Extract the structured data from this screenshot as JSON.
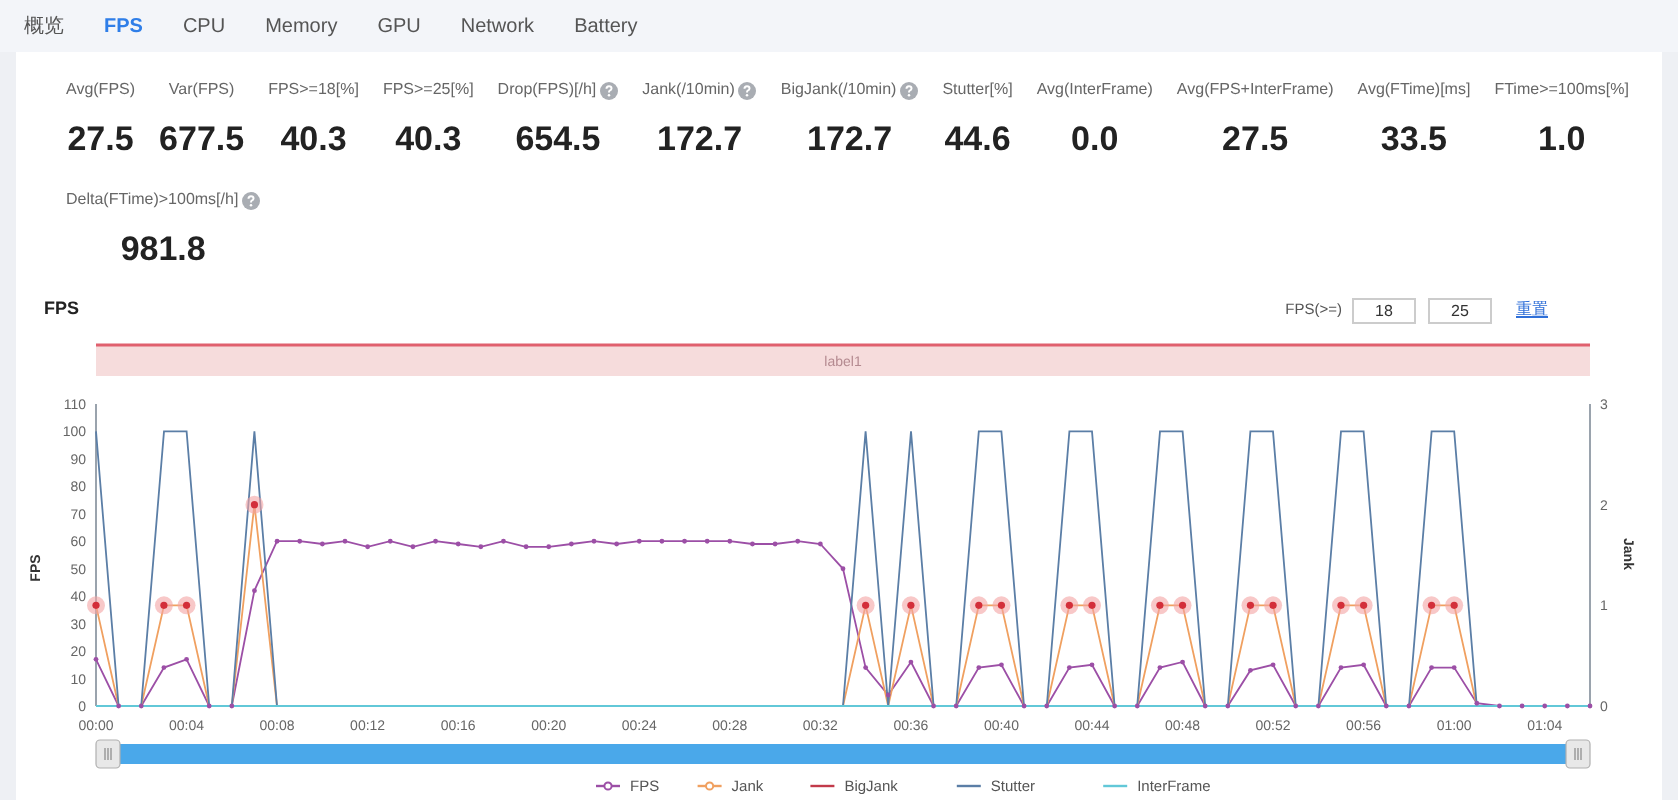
{
  "tabs": [
    {
      "label": "概览",
      "selected": false
    },
    {
      "label": "FPS",
      "selected": true
    },
    {
      "label": "CPU",
      "selected": false
    },
    {
      "label": "Memory",
      "selected": false
    },
    {
      "label": "GPU",
      "selected": false
    },
    {
      "label": "Network",
      "selected": false
    },
    {
      "label": "Battery",
      "selected": false
    }
  ],
  "metric_rows": [
    [
      {
        "label": "Avg(FPS)",
        "value": "27.5",
        "help": false
      },
      {
        "label": "Var(FPS)",
        "value": "677.5",
        "help": false
      },
      {
        "label": "FPS>=18[%]",
        "value": "40.3",
        "help": false
      },
      {
        "label": "FPS>=25[%]",
        "value": "40.3",
        "help": false
      },
      {
        "label": "Drop(FPS)[/h]",
        "value": "654.5",
        "help": true
      },
      {
        "label": "Jank(/10min)",
        "value": "172.7",
        "help": true
      },
      {
        "label": "BigJank(/10min)",
        "value": "172.7",
        "help": true
      },
      {
        "label": "Stutter[%]",
        "value": "44.6",
        "help": false
      },
      {
        "label": "Avg(InterFrame)",
        "value": "0.0",
        "help": false
      },
      {
        "label": "Avg(FPS+InterFrame)",
        "value": "27.5",
        "help": false
      },
      {
        "label": "Avg(FTime)[ms]",
        "value": "33.5",
        "help": false
      },
      {
        "label": "FTime>=100ms[%]",
        "value": "1.0",
        "help": false
      }
    ],
    [
      {
        "label": "Delta(FTime)>100ms[/h]",
        "value": "981.8",
        "help": true
      }
    ]
  ],
  "chart": {
    "filter_label": "FPS(>=)",
    "thresholds": [
      "18",
      "25"
    ],
    "reset_link": "重置",
    "chart_data": {
      "type": "line",
      "title": "FPS",
      "ylabel": "FPS",
      "y2label": "Jank",
      "x": [
        0,
        1,
        2,
        3,
        4,
        5,
        6,
        7,
        8,
        9,
        10,
        11,
        12,
        13,
        14,
        15,
        16,
        17,
        18,
        19,
        20,
        21,
        22,
        23,
        24,
        25,
        26,
        27,
        28,
        29,
        30,
        31,
        32,
        33,
        34,
        35,
        36,
        37,
        38,
        39,
        40,
        41,
        42,
        43,
        44,
        45,
        46,
        47,
        48,
        49,
        50,
        51,
        52,
        53,
        54,
        55,
        56,
        57,
        58,
        59,
        60,
        61,
        62,
        63,
        64,
        65,
        66
      ],
      "xticks": [
        {
          "value": 0,
          "label": "00:00"
        },
        {
          "value": 4,
          "label": "00:04"
        },
        {
          "value": 8,
          "label": "00:08"
        },
        {
          "value": 12,
          "label": "00:12"
        },
        {
          "value": 16,
          "label": "00:16"
        },
        {
          "value": 20,
          "label": "00:20"
        },
        {
          "value": 24,
          "label": "00:24"
        },
        {
          "value": 28,
          "label": "00:28"
        },
        {
          "value": 32,
          "label": "00:32"
        },
        {
          "value": 36,
          "label": "00:36"
        },
        {
          "value": 40,
          "label": "00:40"
        },
        {
          "value": 44,
          "label": "00:44"
        },
        {
          "value": 48,
          "label": "00:48"
        },
        {
          "value": 52,
          "label": "00:52"
        },
        {
          "value": 56,
          "label": "00:56"
        },
        {
          "value": 60,
          "label": "01:00"
        },
        {
          "value": 64,
          "label": "01:04"
        }
      ],
      "ylim": [
        0,
        110
      ],
      "yticks": [
        0,
        10,
        20,
        30,
        40,
        50,
        60,
        70,
        80,
        90,
        100,
        110
      ],
      "y2lim": [
        0,
        3
      ],
      "y2ticks": [
        0,
        1,
        2,
        3
      ],
      "series": [
        {
          "name": "FPS",
          "color": "#9c4fa6",
          "values": [
            17,
            0,
            0,
            14,
            17,
            0,
            0,
            42,
            60,
            60,
            59,
            60,
            58,
            60,
            58,
            60,
            59,
            58,
            60,
            58,
            58,
            59,
            60,
            59,
            60,
            60,
            60,
            60,
            60,
            59,
            59,
            60,
            59,
            50,
            14,
            4,
            16,
            0,
            0,
            14,
            15,
            0,
            0,
            14,
            15,
            0,
            0,
            14,
            16,
            0,
            0,
            13,
            15,
            0,
            0,
            14,
            15,
            0,
            0,
            14,
            14,
            1,
            0,
            0,
            0,
            0,
            0
          ]
        },
        {
          "name": "Jank",
          "color": "#f0a060",
          "axis": "y2",
          "values": [
            1,
            0,
            0,
            1,
            1,
            0,
            0,
            2,
            0,
            0,
            0,
            0,
            0,
            0,
            0,
            0,
            0,
            0,
            0,
            0,
            0,
            0,
            0,
            0,
            0,
            0,
            0,
            0,
            0,
            0,
            0,
            0,
            0,
            0,
            1,
            0,
            1,
            0,
            0,
            1,
            1,
            0,
            0,
            1,
            1,
            0,
            0,
            1,
            1,
            0,
            0,
            1,
            1,
            0,
            0,
            1,
            1,
            0,
            0,
            1,
            1,
            0,
            0,
            null,
            null,
            null,
            null
          ]
        },
        {
          "name": "BigJank",
          "color": "#c23a4a",
          "axis": "y2",
          "values": [
            null,
            null,
            null,
            null,
            null,
            null,
            null,
            null,
            null,
            null,
            null,
            null,
            null,
            null,
            null,
            null,
            null,
            null,
            null,
            null,
            null,
            null,
            null,
            null,
            null,
            null,
            null,
            null,
            null,
            null,
            null,
            null,
            null,
            null,
            null,
            null,
            null,
            null,
            null,
            null,
            null,
            null,
            null,
            null,
            null,
            null,
            null,
            null,
            null,
            null,
            null,
            null,
            null,
            null,
            null,
            null,
            null,
            null,
            null,
            null,
            null,
            null,
            null,
            null,
            null,
            null,
            null
          ]
        },
        {
          "name": "Stutter",
          "color": "#5b7ea6",
          "values": [
            100,
            0,
            0,
            100,
            100,
            0,
            0,
            100,
            0,
            0,
            0,
            0,
            0,
            0,
            0,
            0,
            0,
            0,
            0,
            0,
            0,
            0,
            0,
            0,
            0,
            0,
            0,
            0,
            0,
            0,
            0,
            0,
            0,
            0,
            100,
            0,
            100,
            0,
            0,
            100,
            100,
            0,
            0,
            100,
            100,
            0,
            0,
            100,
            100,
            0,
            0,
            100,
            100,
            0,
            0,
            100,
            100,
            0,
            0,
            100,
            100,
            0,
            0,
            0,
            0,
            0,
            0
          ]
        },
        {
          "name": "InterFrame",
          "color": "#62c8d8",
          "values": [
            0,
            0,
            0,
            0,
            0,
            0,
            0,
            0,
            0,
            0,
            0,
            0,
            0,
            0,
            0,
            0,
            0,
            0,
            0,
            0,
            0,
            0,
            0,
            0,
            0,
            0,
            0,
            0,
            0,
            0,
            0,
            0,
            0,
            0,
            0,
            0,
            0,
            0,
            0,
            0,
            0,
            0,
            0,
            0,
            0,
            0,
            0,
            0,
            0,
            0,
            0,
            0,
            0,
            0,
            0,
            0,
            0,
            0,
            0,
            0,
            0,
            0,
            0,
            0,
            0,
            0,
            0
          ]
        }
      ],
      "xlim": [
        0,
        66
      ],
      "legend": true
    },
    "marked_area_label": "label1"
  }
}
